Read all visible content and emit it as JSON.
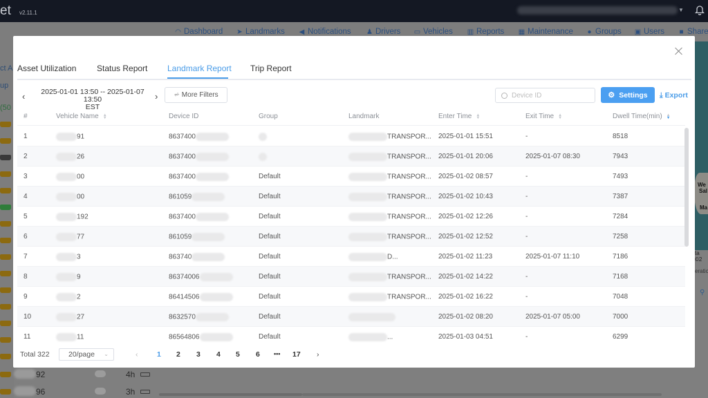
{
  "app": {
    "brand_fragment": "et",
    "version": "v2.11.1"
  },
  "nav": [
    {
      "label": "Dashboard",
      "icon": "dashboard-icon"
    },
    {
      "label": "Landmarks",
      "icon": "navigation-arrow-icon"
    },
    {
      "label": "Notifications",
      "icon": "speaker-icon"
    },
    {
      "label": "Drivers",
      "icon": "driver-icon"
    },
    {
      "label": "Vehicles",
      "icon": "vehicle-icon"
    },
    {
      "label": "Reports",
      "icon": "bar-chart-icon"
    },
    {
      "label": "Maintenance",
      "icon": "calendar-icon"
    },
    {
      "label": "Groups",
      "icon": "group-icon"
    },
    {
      "label": "Users",
      "icon": "users-icon"
    },
    {
      "label": "Share",
      "icon": "folder-share-icon"
    }
  ],
  "background": {
    "left_fragments": [
      "ct Al",
      "up",
      "(50"
    ],
    "rows": [
      {
        "name_suffix": "92",
        "hours": "4h"
      },
      {
        "name_suffix": "96",
        "hours": "3h"
      }
    ],
    "map_labels": [
      "We",
      "Sal",
      "Ma"
    ],
    "map_footer": "ta ©2",
    "map_footer2": "eratio"
  },
  "modal": {
    "tabs": [
      {
        "label": "Asset Utilization",
        "active": false
      },
      {
        "label": "Status Report",
        "active": false
      },
      {
        "label": "Landmark Report",
        "active": true
      },
      {
        "label": "Trip Report",
        "active": false
      }
    ],
    "date_range": {
      "line1": "2025-01-01 13:50 -- 2025-01-07 13:50",
      "line2": "EST"
    },
    "more_filters_label": "More Filters",
    "search_placeholder": "Device ID",
    "settings_label": "Settings",
    "export_label": "Export",
    "columns": [
      {
        "label": "#",
        "sortable": false
      },
      {
        "label": "Vehicle Name",
        "sortable": true
      },
      {
        "label": "Device ID",
        "sortable": false
      },
      {
        "label": "Group",
        "sortable": false
      },
      {
        "label": "Landmark",
        "sortable": false
      },
      {
        "label": "Enter Time",
        "sortable": true
      },
      {
        "label": "Exit Time",
        "sortable": true
      },
      {
        "label": "Dwell Time(min)",
        "sortable": true,
        "sorted": "desc"
      }
    ],
    "rows": [
      {
        "index": "1",
        "vehicle_suffix": "91",
        "device_prefix": "8637400",
        "group": "",
        "landmark_suffix": "TRANSPOR...",
        "enter": "2025-01-01 15:51",
        "exit": "-",
        "dwell": "8518"
      },
      {
        "index": "2",
        "vehicle_suffix": "26",
        "device_prefix": "8637400",
        "group": "",
        "landmark_suffix": "TRANSPOR...",
        "enter": "2025-01-01 20:06",
        "exit": "2025-01-07 08:30",
        "dwell": "7943"
      },
      {
        "index": "3",
        "vehicle_suffix": "00",
        "device_prefix": "8637400",
        "group": "Default",
        "landmark_suffix": "TRANSPOR...",
        "enter": "2025-01-02 08:57",
        "exit": "-",
        "dwell": "7493"
      },
      {
        "index": "4",
        "vehicle_suffix": "00",
        "device_prefix": "861059",
        "group": "Default",
        "landmark_suffix": "TRANSPOR...",
        "enter": "2025-01-02 10:43",
        "exit": "-",
        "dwell": "7387"
      },
      {
        "index": "5",
        "vehicle_suffix": "192",
        "device_prefix": "8637400",
        "group": "Default",
        "landmark_suffix": "TRANSPOR...",
        "enter": "2025-01-02 12:26",
        "exit": "-",
        "dwell": "7284"
      },
      {
        "index": "6",
        "vehicle_suffix": "77",
        "device_prefix": "861059",
        "group": "Default",
        "landmark_suffix": "TRANSPOR...",
        "enter": "2025-01-02 12:52",
        "exit": "-",
        "dwell": "7258"
      },
      {
        "index": "7",
        "vehicle_suffix": "3",
        "device_prefix": "863740",
        "group": "Default",
        "landmark_suffix": "D...",
        "enter": "2025-01-02 11:23",
        "exit": "2025-01-07 11:10",
        "dwell": "7186"
      },
      {
        "index": "8",
        "vehicle_suffix": "9",
        "device_prefix": "86374006",
        "group": "Default",
        "landmark_suffix": "TRANSPOR...",
        "enter": "2025-01-02 14:22",
        "exit": "-",
        "dwell": "7168"
      },
      {
        "index": "9",
        "vehicle_suffix": "2",
        "device_prefix": "86414506",
        "group": "Default",
        "landmark_suffix": "TRANSPOR...",
        "enter": "2025-01-02 16:22",
        "exit": "-",
        "dwell": "7048"
      },
      {
        "index": "10",
        "vehicle_suffix": "27",
        "device_prefix": "8632570",
        "group": "Default",
        "landmark_suffix": "",
        "enter": "2025-01-02 08:20",
        "exit": "2025-01-07 05:00",
        "dwell": "7000"
      },
      {
        "index": "11",
        "vehicle_suffix": "11",
        "device_prefix": "86564806",
        "group": "Default",
        "landmark_suffix": "...",
        "enter": "2025-01-03 04:51",
        "exit": "-",
        "dwell": "6299"
      }
    ],
    "pagination": {
      "total_label": "Total 322",
      "page_size": "20/page",
      "pages": [
        "1",
        "2",
        "3",
        "4",
        "5",
        "6",
        "•••",
        "17"
      ],
      "current_page": "1"
    }
  }
}
